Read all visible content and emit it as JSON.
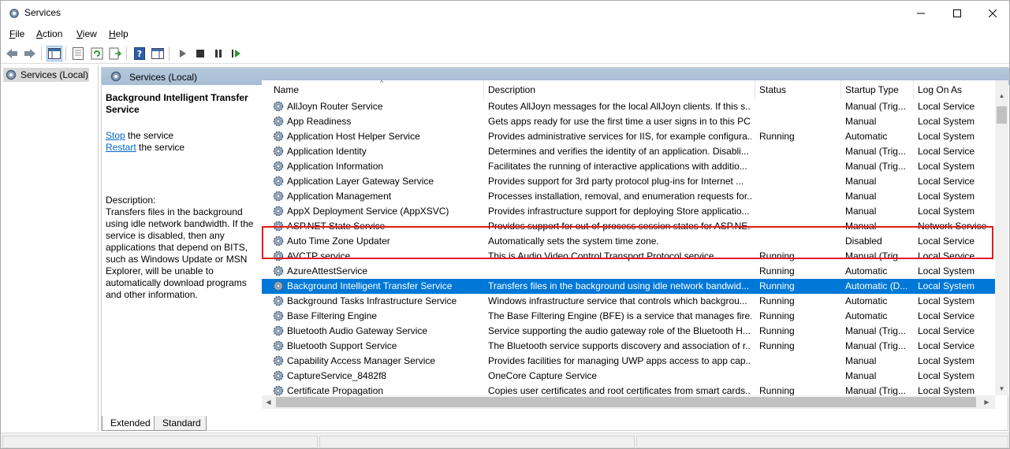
{
  "window": {
    "title": "Services"
  },
  "menu": [
    {
      "label": "File",
      "u": "F",
      "rest": "ile"
    },
    {
      "label": "Action",
      "u": "A",
      "rest": "ction"
    },
    {
      "label": "View",
      "u": "V",
      "rest": "iew"
    },
    {
      "label": "Help",
      "u": "H",
      "rest": "elp"
    }
  ],
  "tree": {
    "root": "Services (Local)"
  },
  "pane_header": "Services (Local)",
  "details": {
    "title": "Background Intelligent Transfer Service",
    "stop_link": "Stop",
    "stop_rest": " the service",
    "restart_link": "Restart",
    "restart_rest": " the service",
    "description_label": "Description:",
    "description": "Transfers files in the background using idle network bandwidth. If the service is disabled, then any applications that depend on BITS, such as Windows Update or MSN Explorer, will be unable to automatically download programs and other information."
  },
  "columns": {
    "name": "Name",
    "description": "Description",
    "status": "Status",
    "startup": "Startup Type",
    "logon": "Log On As"
  },
  "services": [
    {
      "name": "AllJoyn Router Service",
      "description": "Routes AllJoyn messages for the local AllJoyn clients. If this s...",
      "status": "",
      "startup": "Manual (Trig...",
      "logon": "Local Service"
    },
    {
      "name": "App Readiness",
      "description": "Gets apps ready for use the first time a user signs in to this PC...",
      "status": "",
      "startup": "Manual",
      "logon": "Local System"
    },
    {
      "name": "Application Host Helper Service",
      "description": "Provides administrative services for IIS, for example configura...",
      "status": "Running",
      "startup": "Automatic",
      "logon": "Local System"
    },
    {
      "name": "Application Identity",
      "description": "Determines and verifies the identity of an application. Disabli...",
      "status": "",
      "startup": "Manual (Trig...",
      "logon": "Local Service"
    },
    {
      "name": "Application Information",
      "description": "Facilitates the running of interactive applications with additio...",
      "status": "",
      "startup": "Manual (Trig...",
      "logon": "Local System"
    },
    {
      "name": "Application Layer Gateway Service",
      "description": "Provides support for 3rd party protocol plug-ins for Internet ...",
      "status": "",
      "startup": "Manual",
      "logon": "Local Service"
    },
    {
      "name": "Application Management",
      "description": "Processes installation, removal, and enumeration requests for...",
      "status": "",
      "startup": "Manual",
      "logon": "Local System"
    },
    {
      "name": "AppX Deployment Service (AppXSVC)",
      "description": "Provides infrastructure support for deploying Store applicatio...",
      "status": "",
      "startup": "Manual",
      "logon": "Local System"
    },
    {
      "name": "ASP.NET State Service",
      "description": "Provides support for out-of-process session states for ASP.NE...",
      "status": "",
      "startup": "Manual",
      "logon": "Network Service"
    },
    {
      "name": "Auto Time Zone Updater",
      "description": "Automatically sets the system time zone.",
      "status": "",
      "startup": "Disabled",
      "logon": "Local Service"
    },
    {
      "name": "AVCTP service",
      "description": "This is Audio Video Control Transport Protocol service",
      "status": "Running",
      "startup": "Manual (Trig...",
      "logon": "Local Service"
    },
    {
      "name": "AzureAttestService",
      "description": "",
      "status": "Running",
      "startup": "Automatic",
      "logon": "Local System"
    },
    {
      "name": "Background Intelligent Transfer Service",
      "description": "Transfers files in the background using idle network bandwid...",
      "status": "Running",
      "startup": "Automatic (D...",
      "logon": "Local System",
      "selected": true
    },
    {
      "name": "Background Tasks Infrastructure Service",
      "description": "Windows infrastructure service that controls which backgrou...",
      "status": "Running",
      "startup": "Automatic",
      "logon": "Local System"
    },
    {
      "name": "Base Filtering Engine",
      "description": "The Base Filtering Engine (BFE) is a service that manages fire...",
      "status": "Running",
      "startup": "Automatic",
      "logon": "Local Service"
    },
    {
      "name": "Bluetooth Audio Gateway Service",
      "description": "Service supporting the audio gateway role of the Bluetooth H...",
      "status": "Running",
      "startup": "Manual (Trig...",
      "logon": "Local Service"
    },
    {
      "name": "Bluetooth Support Service",
      "description": "The Bluetooth service supports discovery and association of r...",
      "status": "Running",
      "startup": "Manual (Trig...",
      "logon": "Local Service"
    },
    {
      "name": "Capability Access Manager Service",
      "description": "Provides facilities for managing UWP apps access to app cap...",
      "status": "",
      "startup": "Manual",
      "logon": "Local System"
    },
    {
      "name": "CaptureService_8482f8",
      "description": "OneCore Capture Service",
      "status": "",
      "startup": "Manual",
      "logon": "Local System"
    },
    {
      "name": "Certificate Propagation",
      "description": "Copies user certificates and root certificates from smart cards...",
      "status": "Running",
      "startup": "Manual (Trig...",
      "logon": "Local System"
    }
  ],
  "tabs": {
    "extended": "Extended",
    "standard": "Standard"
  },
  "colors": {
    "selection": "#0078d7",
    "highlight_box": "#e31a1a",
    "header": "#a6bdd5",
    "link": "#0066cc"
  }
}
